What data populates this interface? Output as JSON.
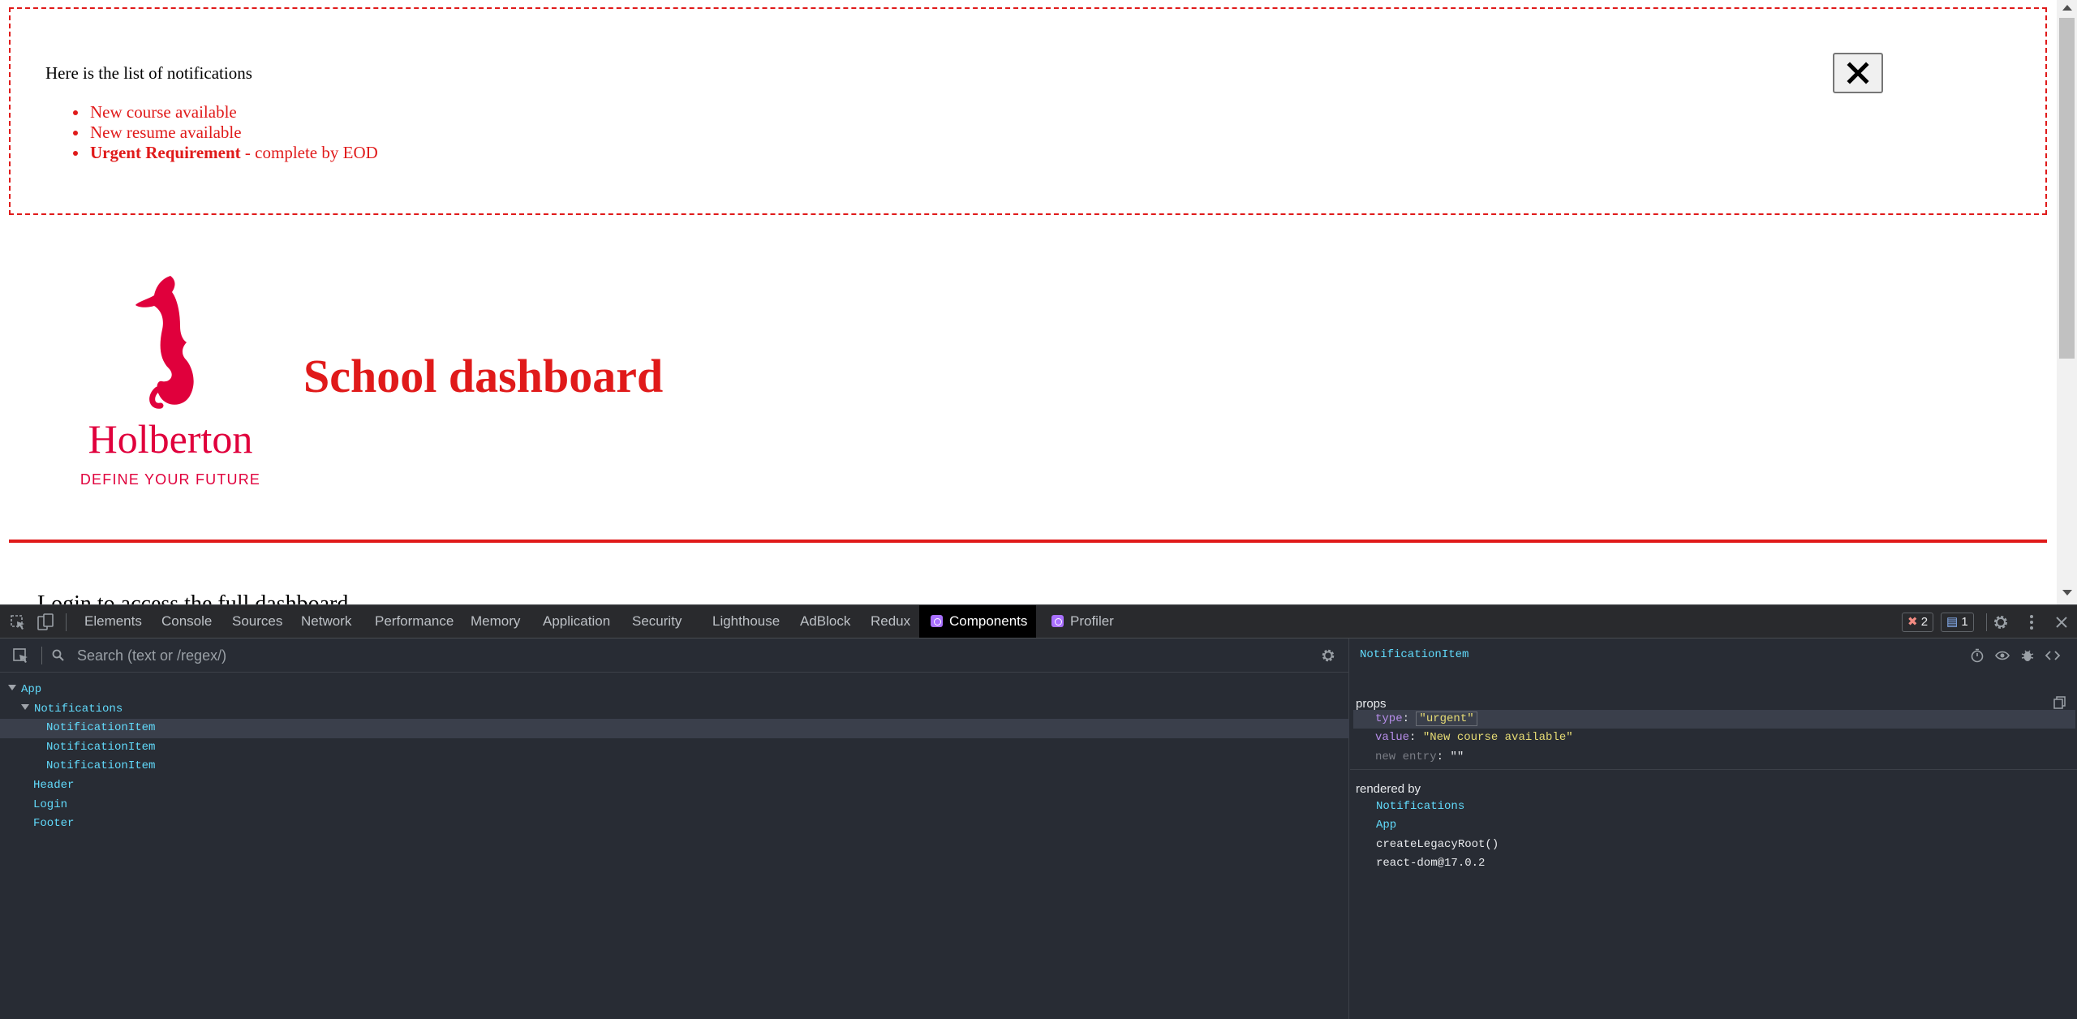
{
  "page": {
    "notifications": {
      "title": "Here is the list of notifications",
      "items": [
        {
          "text": "New course available"
        },
        {
          "text": "New resume available"
        },
        {
          "bold": "Urgent Requirement",
          "rest": " - complete by EOD"
        }
      ],
      "close_label": "Close"
    },
    "logo": {
      "word": "Holberton",
      "tagline": "DEFINE YOUR FUTURE"
    },
    "title": "School dashboard",
    "login_text": "Login to access the full dashboard",
    "colors": {
      "accent": "#e01a1a",
      "brand": "#e0003c"
    }
  },
  "devtools": {
    "tabs": [
      {
        "label": "Elements"
      },
      {
        "label": "Console"
      },
      {
        "label": "Sources"
      },
      {
        "label": "Network"
      },
      {
        "label": "Performance"
      },
      {
        "label": "Memory"
      },
      {
        "label": "Application"
      },
      {
        "label": "Security"
      },
      {
        "label": "Lighthouse"
      },
      {
        "label": "AdBlock"
      },
      {
        "label": "Redux"
      },
      {
        "label": "Components",
        "active": true
      },
      {
        "label": "Profiler"
      }
    ],
    "error_count": "2",
    "message_count": "1",
    "search_placeholder": "Search (text or /regex/)",
    "tree": [
      {
        "label": "App",
        "depth": 0,
        "expanded": true
      },
      {
        "label": "Notifications",
        "depth": 1,
        "expanded": true
      },
      {
        "label": "NotificationItem",
        "depth": 2,
        "selected": true
      },
      {
        "label": "NotificationItem",
        "depth": 2
      },
      {
        "label": "NotificationItem",
        "depth": 2
      },
      {
        "label": "Header",
        "depth": 1
      },
      {
        "label": "Login",
        "depth": 1
      },
      {
        "label": "Footer",
        "depth": 1
      }
    ],
    "inspector": {
      "component_name": "NotificationItem",
      "props_label": "props",
      "props": [
        {
          "key": "type",
          "value": "\"urgent\""
        },
        {
          "key": "value",
          "value": "\"New course available\""
        },
        {
          "key": "new entry",
          "value": "\"\""
        }
      ],
      "rendered_by_label": "rendered by",
      "rendered_by": [
        "Notifications",
        "App",
        "createLegacyRoot()",
        "react-dom@17.0.2"
      ]
    }
  }
}
